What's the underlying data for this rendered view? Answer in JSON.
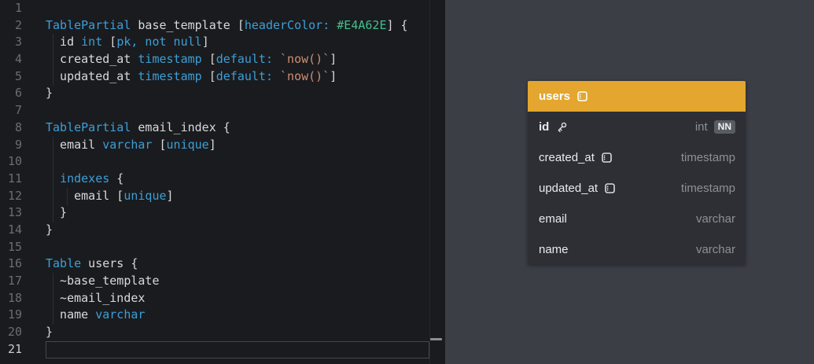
{
  "editor": {
    "active_line": 21,
    "lines": [
      {
        "n": 1,
        "tokens": []
      },
      {
        "n": 2,
        "tokens": [
          [
            "kw",
            "TablePartial"
          ],
          [
            "pl",
            " base_template ["
          ],
          [
            "kw",
            "headerColor:"
          ],
          [
            "pl",
            " "
          ],
          [
            "clr",
            "#E4A62E"
          ],
          [
            "pl",
            "] {"
          ]
        ]
      },
      {
        "n": 3,
        "tokens": [
          [
            "pl",
            "  id "
          ],
          [
            "kw",
            "int"
          ],
          [
            "pl",
            " ["
          ],
          [
            "kw",
            "pk, not null"
          ],
          [
            "pl",
            "]"
          ]
        ]
      },
      {
        "n": 4,
        "tokens": [
          [
            "pl",
            "  created_at "
          ],
          [
            "kw",
            "timestamp"
          ],
          [
            "pl",
            " ["
          ],
          [
            "kw",
            "default:"
          ],
          [
            "pl",
            " "
          ],
          [
            "str",
            "`now()`"
          ],
          [
            "pl",
            "]"
          ]
        ]
      },
      {
        "n": 5,
        "tokens": [
          [
            "pl",
            "  updated_at "
          ],
          [
            "kw",
            "timestamp"
          ],
          [
            "pl",
            " ["
          ],
          [
            "kw",
            "default:"
          ],
          [
            "pl",
            " "
          ],
          [
            "str",
            "`now()`"
          ],
          [
            "pl",
            "]"
          ]
        ]
      },
      {
        "n": 6,
        "tokens": [
          [
            "pl",
            "}"
          ]
        ]
      },
      {
        "n": 7,
        "tokens": []
      },
      {
        "n": 8,
        "tokens": [
          [
            "kw",
            "TablePartial"
          ],
          [
            "pl",
            " email_index {"
          ]
        ]
      },
      {
        "n": 9,
        "tokens": [
          [
            "pl",
            "  email "
          ],
          [
            "kw",
            "varchar"
          ],
          [
            "pl",
            " ["
          ],
          [
            "kw",
            "unique"
          ],
          [
            "pl",
            "]"
          ]
        ]
      },
      {
        "n": 10,
        "tokens": []
      },
      {
        "n": 11,
        "tokens": [
          [
            "pl",
            "  "
          ],
          [
            "kw",
            "indexes"
          ],
          [
            "pl",
            " {"
          ]
        ]
      },
      {
        "n": 12,
        "tokens": [
          [
            "pl",
            "    email ["
          ],
          [
            "kw",
            "unique"
          ],
          [
            "pl",
            "]"
          ]
        ]
      },
      {
        "n": 13,
        "tokens": [
          [
            "pl",
            "  }"
          ]
        ]
      },
      {
        "n": 14,
        "tokens": [
          [
            "pl",
            "}"
          ]
        ]
      },
      {
        "n": 15,
        "tokens": []
      },
      {
        "n": 16,
        "tokens": [
          [
            "kw",
            "Table"
          ],
          [
            "pl",
            " users {"
          ]
        ]
      },
      {
        "n": 17,
        "tokens": [
          [
            "pl",
            "  ~base_template"
          ]
        ]
      },
      {
        "n": 18,
        "tokens": [
          [
            "pl",
            "  ~email_index"
          ]
        ]
      },
      {
        "n": 19,
        "tokens": [
          [
            "pl",
            "  name "
          ],
          [
            "kw",
            "varchar"
          ]
        ]
      },
      {
        "n": 20,
        "tokens": [
          [
            "pl",
            "}"
          ]
        ]
      },
      {
        "n": 21,
        "tokens": []
      }
    ]
  },
  "diagram": {
    "table": {
      "title": "users",
      "header_color": "#E4A62E",
      "title_icon": "partial-icon",
      "fields": [
        {
          "name": "id",
          "type": "int",
          "pk": true,
          "icon": "key-icon",
          "badge": "NN"
        },
        {
          "name": "created_at",
          "type": "timestamp",
          "pk": false,
          "icon": "partial-icon",
          "badge": ""
        },
        {
          "name": "updated_at",
          "type": "timestamp",
          "pk": false,
          "icon": "partial-icon",
          "badge": ""
        },
        {
          "name": "email",
          "type": "varchar",
          "pk": false,
          "icon": "",
          "badge": ""
        },
        {
          "name": "name",
          "type": "varchar",
          "pk": false,
          "icon": "",
          "badge": ""
        }
      ]
    }
  }
}
